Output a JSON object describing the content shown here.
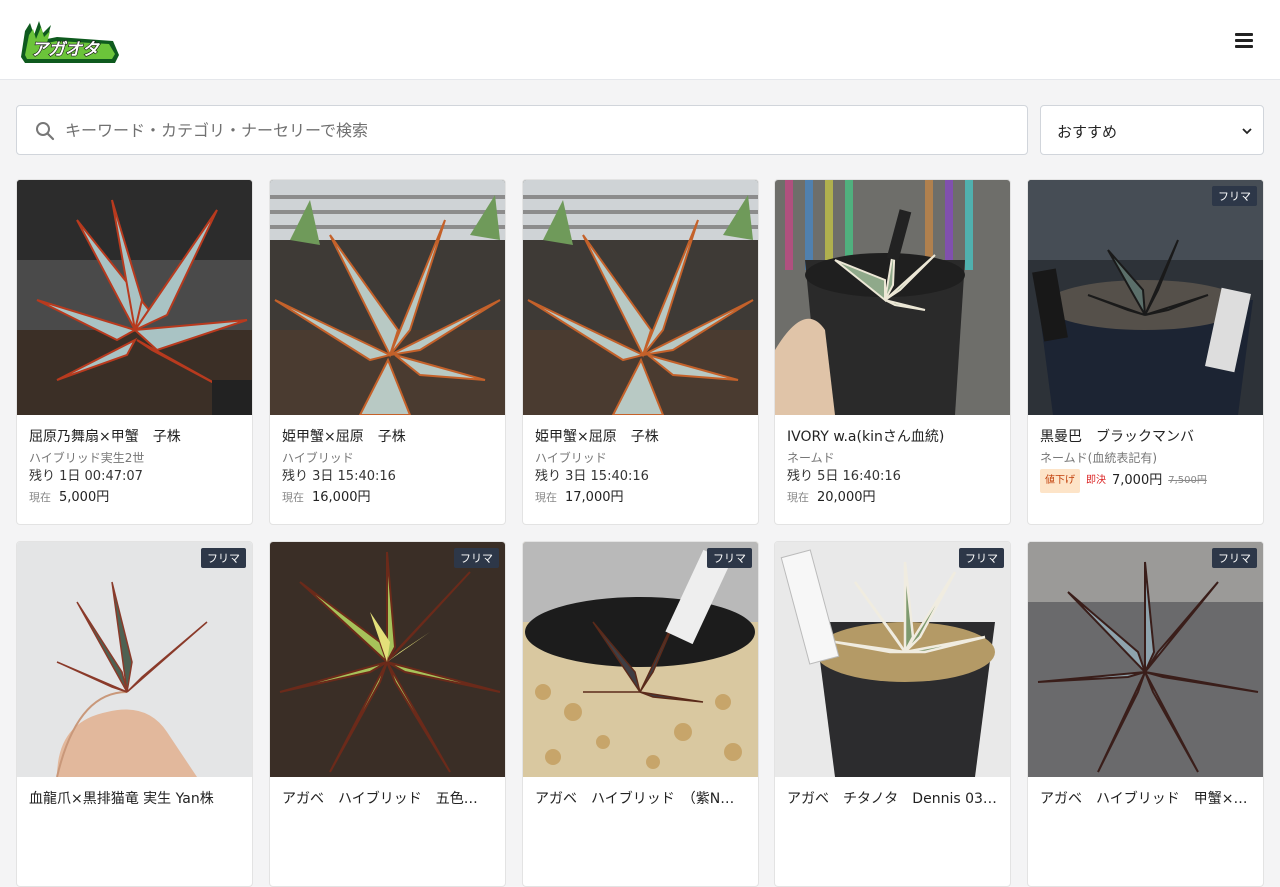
{
  "header": {
    "logo_text": "アガオタ",
    "menu_icon": "menu-icon"
  },
  "search": {
    "placeholder": "キーワード・カテゴリ・ナーセリーで検索",
    "icon": "search-icon"
  },
  "sort": {
    "selected": "おすすめ"
  },
  "labels": {
    "current": "現在",
    "price_down": "値下げ",
    "instant": "即決"
  },
  "products": [
    {
      "title": "屈原乃舞扇×甲蟹　子株",
      "category": "ハイブリッド実生2世",
      "remaining": "残り 1日 00:47:07",
      "price": "5,000円"
    },
    {
      "title": "姫甲蟹×屈原　子株",
      "category": "ハイブリッド",
      "remaining": "残り 3日 15:40:16",
      "price": "16,000円"
    },
    {
      "title": "姫甲蟹×屈原　子株",
      "category": "ハイブリッド",
      "remaining": "残り 3日 15:40:16",
      "price": "17,000円"
    },
    {
      "title": "IVORY w.a(kinさん血統)",
      "category": "ネームド",
      "remaining": "残り 5日 16:40:16",
      "price": "20,000円"
    },
    {
      "title": "黒曼巴　ブラックマンバ",
      "category": "ネームド(血統表記有)",
      "badge": "フリマ",
      "price": "7,000円",
      "old_price": "7,500円"
    },
    {
      "title": "血龍爪×黒排猫竜 実生 Yan株",
      "badge": "フリマ"
    },
    {
      "title": "アガベ　ハイブリッド　五色…",
      "badge": "フリマ"
    },
    {
      "title": "アガベ　ハイブリッド　（紫N…",
      "badge": "フリマ"
    },
    {
      "title": "アガベ　チタノタ　Dennis 03…",
      "badge": "フリマ"
    },
    {
      "title": "アガベ　ハイブリッド　甲蟹×…",
      "badge": "フリマ"
    }
  ],
  "colors": {
    "badge_bg": "#2d3748",
    "price_down_bg": "#fde4c8",
    "instant": "#dc2626"
  }
}
